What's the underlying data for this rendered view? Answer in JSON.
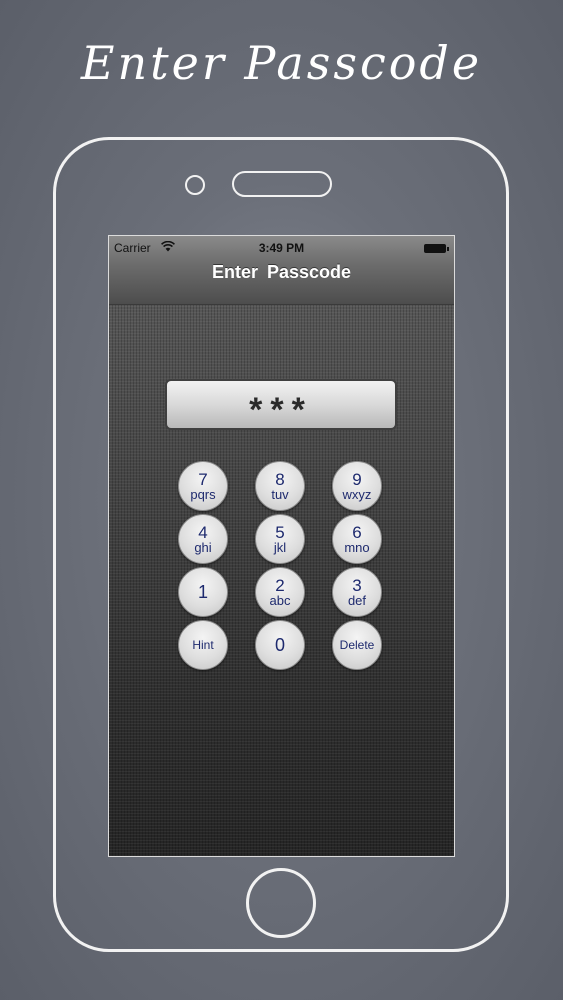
{
  "promo": {
    "title": "Enter Passcode"
  },
  "status_bar": {
    "carrier": "Carrier",
    "time": "3:49 PM"
  },
  "navbar": {
    "title": "Enter  Passcode"
  },
  "passcode": {
    "masked_value": "***"
  },
  "keypad": {
    "k7": {
      "digit": "7",
      "letters": "pqrs"
    },
    "k8": {
      "digit": "8",
      "letters": "tuv"
    },
    "k9": {
      "digit": "9",
      "letters": "wxyz"
    },
    "k4": {
      "digit": "4",
      "letters": "ghi"
    },
    "k5": {
      "digit": "5",
      "letters": "jkl"
    },
    "k6": {
      "digit": "6",
      "letters": "mno"
    },
    "k1": {
      "digit": "1"
    },
    "k2": {
      "digit": "2",
      "letters": "abc"
    },
    "k3": {
      "digit": "3",
      "letters": "def"
    },
    "hint": "Hint",
    "k0": {
      "digit": "0"
    },
    "delete": "Delete"
  },
  "colors": {
    "key_text": "#1e2a6e",
    "frame_outline": "#f2f2f2"
  },
  "icons": {
    "wifi": "wifi-icon",
    "battery": "battery-icon"
  }
}
